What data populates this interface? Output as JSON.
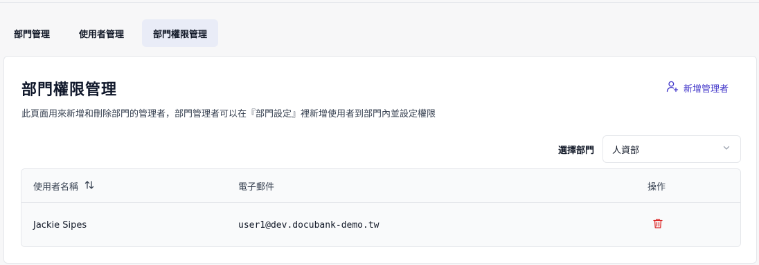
{
  "tabs": [
    {
      "label": "部門管理",
      "active": false
    },
    {
      "label": "使用者管理",
      "active": false
    },
    {
      "label": "部門權限管理",
      "active": true
    }
  ],
  "card": {
    "title": "部門權限管理",
    "description": "此頁面用來新增和刪除部門的管理者，部門管理者可以在『部門設定』裡新增使用者到部門內並設定權限",
    "add_button_label": "新增管理者",
    "add_button_icon": "add-user-icon"
  },
  "filter": {
    "label": "選擇部門",
    "selected": "人資部"
  },
  "table": {
    "columns": [
      "使用者名稱",
      "電子郵件",
      "操作"
    ],
    "rows": [
      {
        "name": "Jackie Sipes",
        "email": "user1@dev.docubank-demo.tw",
        "action_icon": "trash-icon"
      }
    ]
  },
  "colors": {
    "accent": "#4338ca",
    "active_tab_bg": "#e9ecf7",
    "danger": "#dc2626"
  }
}
